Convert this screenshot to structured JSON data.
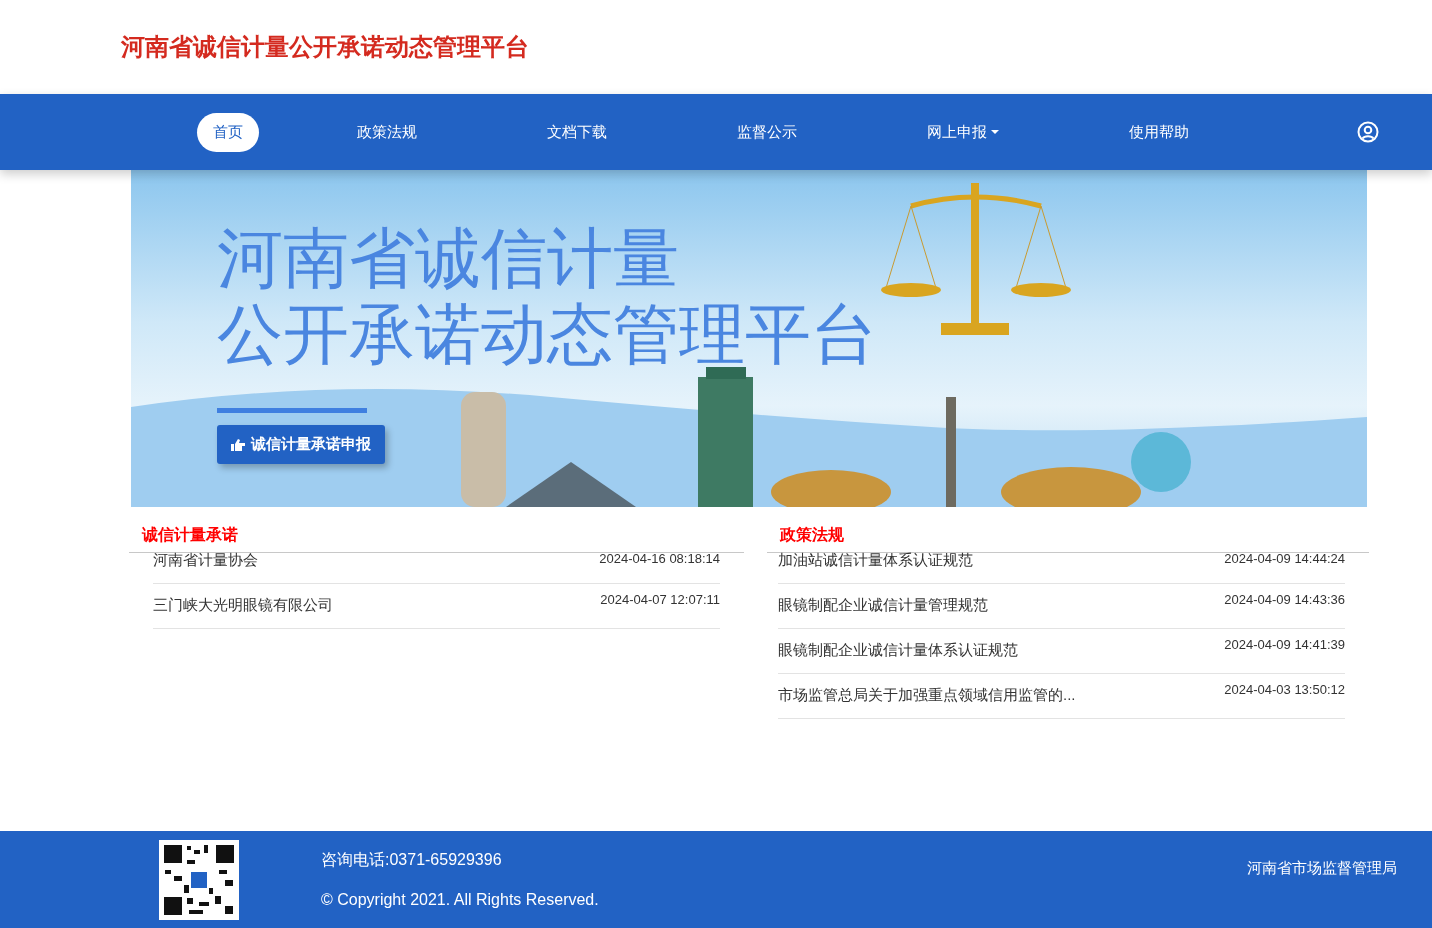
{
  "header": {
    "site_title": "河南省诚信计量公开承诺动态管理平台"
  },
  "nav": {
    "items": [
      {
        "label": "首页",
        "selected": true,
        "dropdown": false
      },
      {
        "label": "政策法规",
        "selected": false,
        "dropdown": false
      },
      {
        "label": "文档下载",
        "selected": false,
        "dropdown": false
      },
      {
        "label": "监督公示",
        "selected": false,
        "dropdown": false
      },
      {
        "label": "网上申报",
        "selected": false,
        "dropdown": true
      },
      {
        "label": "使用帮助",
        "selected": false,
        "dropdown": false
      }
    ]
  },
  "banner": {
    "title_lines": [
      "河南省诚信计量",
      "公开承诺动态管理平台"
    ],
    "button": "诚信计量承诺申报"
  },
  "panels": [
    {
      "title": "诚信计量承诺",
      "rows": [
        {
          "text": "河南省计量协会",
          "time": "2024-04-16 08:18:14"
        },
        {
          "text": "三门峡大光明眼镜有限公司",
          "time": "2024-04-07 12:07:11"
        }
      ]
    },
    {
      "title": "政策法规",
      "rows": [
        {
          "text": "加油站诚信计量体系认证规范",
          "time": "2024-04-09 14:44:24"
        },
        {
          "text": "眼镜制配企业诚信计量管理规范",
          "time": "2024-04-09 14:43:36"
        },
        {
          "text": "眼镜制配企业诚信计量体系认证规范",
          "time": "2024-04-09 14:41:39"
        },
        {
          "text": "市场监管总局关于加强重点领域信用监管的...",
          "time": "2024-04-03 13:50:12"
        }
      ]
    }
  ],
  "footer": {
    "phone": "咨询电话:0371-65929396",
    "copyright": "© Copyright 2021. All Rights Reserved.",
    "agency": "河南省市场监督管理局"
  }
}
